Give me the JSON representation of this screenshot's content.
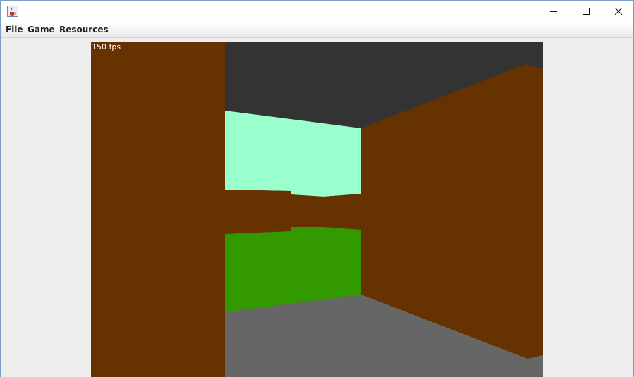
{
  "window": {
    "title": "",
    "icon": "java-coffee-cup-icon",
    "controls": [
      "minimize-icon",
      "maximize-icon",
      "close-icon"
    ]
  },
  "menubar": {
    "items": [
      "File",
      "Game",
      "Resources"
    ]
  },
  "game": {
    "fps_label": "150 fps",
    "colors": {
      "ceiling": "#333333",
      "floor": "#666666",
      "wall_brown": "#663300",
      "wall_mint": "#99ffcc",
      "wall_green": "#339900"
    }
  }
}
